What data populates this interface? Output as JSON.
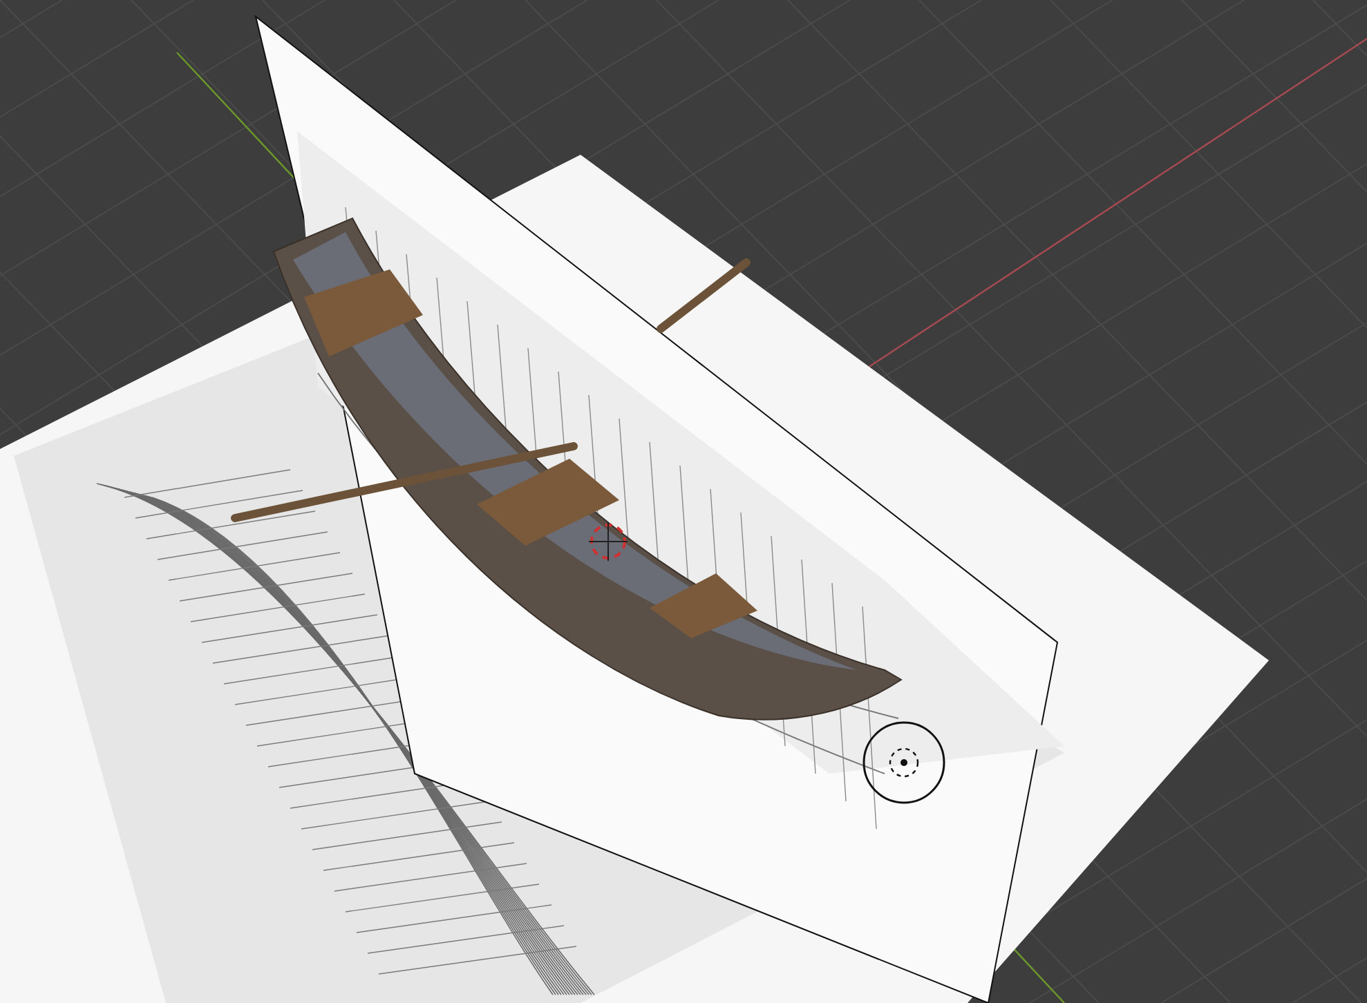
{
  "viewport": {
    "objects": [
      {
        "kind": "floor_reference"
      },
      {
        "kind": "side_reference"
      },
      {
        "kind": "boat"
      },
      {
        "kind": "oar"
      },
      {
        "kind": "cursor"
      },
      {
        "kind": "light"
      }
    ]
  }
}
